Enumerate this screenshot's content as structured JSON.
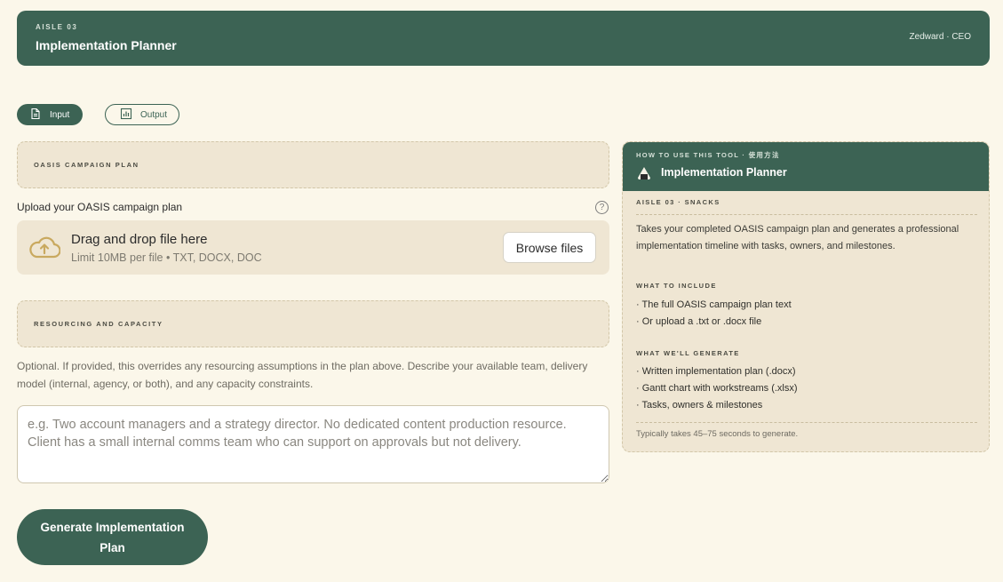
{
  "header": {
    "aisle": "AISLE 03",
    "title": "Implementation Planner",
    "user": "Zedward · CEO"
  },
  "tabs": [
    {
      "label": "Input",
      "icon": "document-icon",
      "active": true
    },
    {
      "label": "Output",
      "icon": "chart-icon",
      "active": false
    }
  ],
  "form": {
    "campaign_section_label": "OASIS CAMPAIGN PLAN",
    "upload_label": "Upload your OASIS campaign plan",
    "help_glyph": "?",
    "dropzone_main": "Drag and drop file here",
    "dropzone_sub": "Limit 10MB per file • TXT, DOCX, DOC",
    "browse_label": "Browse files",
    "resourcing_section_label": "RESOURCING AND CAPACITY",
    "optional_text": "Optional. If provided, this overrides any resourcing assumptions in the plan above. Describe your available team, delivery model (internal, agency, or both), and any capacity constraints.",
    "textarea_placeholder": "e.g. Two account managers and a strategy director. No dedicated content production resource. Client has a small internal comms team who can support on approvals but not delivery.",
    "textarea_value": "",
    "generate_label": "Generate Implementation Plan"
  },
  "panel": {
    "how_to": "HOW TO USE THIS TOOL · 使用方法",
    "title": "Implementation Planner",
    "aisle": "AISLE 03 · SNACKS",
    "description": "Takes your completed OASIS campaign plan and generates a professional implementation timeline with tasks, owners, and milestones.",
    "include_heading": "WHAT TO INCLUDE",
    "include_items": [
      "· The full OASIS campaign plan text",
      "· Or upload a .txt or .docx file"
    ],
    "generate_heading": "WHAT WE'LL GENERATE",
    "generate_items": [
      "· Written implementation plan (.docx)",
      "· Gantt chart with workstreams (.xlsx)",
      "· Tasks, owners & milestones"
    ],
    "footnote": "Typically takes 45–75 seconds to generate."
  },
  "colors": {
    "brand_green": "#3c6354",
    "background": "#fbf7ea",
    "panel_beige": "#efe6d3",
    "accent_gold": "#c9a95f"
  }
}
